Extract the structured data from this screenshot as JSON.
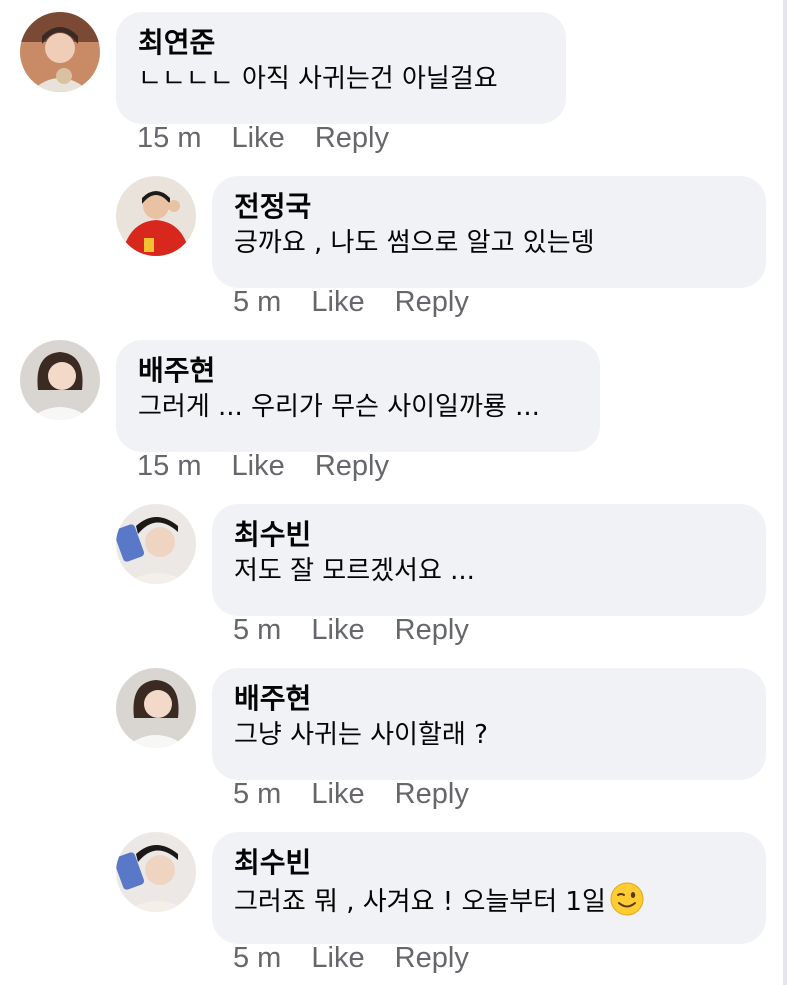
{
  "comments": [
    {
      "author": "최연준",
      "text": "ㄴㄴㄴㄴ 아직 사귀는건 아닐걸요",
      "time": "15 m",
      "like": "Like",
      "reply": "Reply",
      "avatar_icon": "avatar-photo-young-man-brown-hair"
    },
    {
      "author": "전정국",
      "text": "긍까요 , 나도 썸으로 알고 있는뎅",
      "time": "5 m",
      "like": "Like",
      "reply": "Reply",
      "avatar_icon": "avatar-photo-man-red-jacket"
    },
    {
      "author": "배주현",
      "text": "그러게 ... 우리가 무슨 사이일까룡 ...",
      "time": "15 m",
      "like": "Like",
      "reply": "Reply",
      "avatar_icon": "avatar-photo-woman-white-shirt"
    },
    {
      "author": "최수빈",
      "text": "저도 잘 모르겠서요 ...",
      "time": "5 m",
      "like": "Like",
      "reply": "Reply",
      "avatar_icon": "avatar-photo-man-holding-phone"
    },
    {
      "author": "배주현",
      "text": "그냥 사귀는 사이할래 ?",
      "time": "5 m",
      "like": "Like",
      "reply": "Reply",
      "avatar_icon": "avatar-photo-woman-white-shirt"
    },
    {
      "author": "최수빈",
      "text": "그러죠 뭐 , 사겨요 ! 오늘부터 1일",
      "time": "5 m",
      "like": "Like",
      "reply": "Reply",
      "avatar_icon": "avatar-photo-man-holding-phone",
      "emoji": "winking-face-emoji"
    }
  ],
  "colors": {
    "bubble": "#f0f2f5",
    "text": "#050505",
    "meta": "#65676b"
  }
}
